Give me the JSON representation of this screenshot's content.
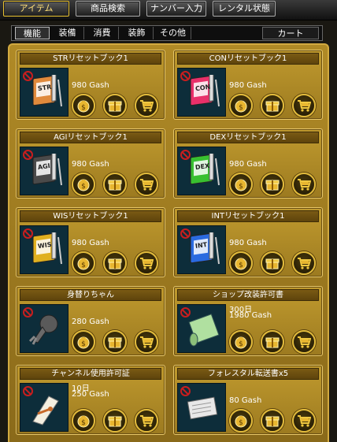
{
  "top_tabs": [
    {
      "label": "アイテム",
      "active": true
    },
    {
      "label": "商品検索",
      "active": false
    },
    {
      "label": "ナンバー入力",
      "active": false
    },
    {
      "label": "レンタル状態",
      "active": false
    }
  ],
  "sub_tabs": [
    {
      "label": "機能",
      "active": true
    },
    {
      "label": "装備",
      "active": false
    },
    {
      "label": "消費",
      "active": false
    },
    {
      "label": "装飾",
      "active": false
    },
    {
      "label": "その他",
      "active": false
    }
  ],
  "cart_label": "カート",
  "items": [
    {
      "name": "STRリセットブック1",
      "duration": "",
      "price": "980 Gash",
      "icon": "str-reset-book-icon",
      "book_color": "#e08a3c",
      "book_text": "STR"
    },
    {
      "name": "CONリセットブック1",
      "duration": "",
      "price": "980 Gash",
      "icon": "con-reset-book-icon",
      "book_color": "#e8306a",
      "book_text": "CON"
    },
    {
      "name": "AGIリセットブック1",
      "duration": "",
      "price": "980 Gash",
      "icon": "agi-reset-book-icon",
      "book_color": "#4a4a4a",
      "book_text": "AGI"
    },
    {
      "name": "DEXリセットブック1",
      "duration": "",
      "price": "980 Gash",
      "icon": "dex-reset-book-icon",
      "book_color": "#38c030",
      "book_text": "DEX"
    },
    {
      "name": "WISリセットブック1",
      "duration": "",
      "price": "980 Gash",
      "icon": "wis-reset-book-icon",
      "book_color": "#e0b020",
      "book_text": "WIS"
    },
    {
      "name": "INTリセットブック1",
      "duration": "",
      "price": "980 Gash",
      "icon": "int-reset-book-icon",
      "book_color": "#2a6ae0",
      "book_text": "INT"
    },
    {
      "name": "身替りちゃん",
      "duration": "",
      "price": "280 Gash",
      "icon": "substitute-doll-icon"
    },
    {
      "name": "ショップ改装許可書",
      "duration": "300日",
      "price": "1980 Gash",
      "icon": "shop-scroll-icon"
    },
    {
      "name": "チャンネル使用許可証",
      "duration": "10日",
      "price": "250 Gash",
      "icon": "channel-scroll-icon"
    },
    {
      "name": "フォレスタル転送書x5",
      "duration": "",
      "price": "80 Gash",
      "icon": "transfer-scroll-icon"
    }
  ],
  "colors": {
    "panel": "#b08a26",
    "card_border": "#e8c86a",
    "button_ring": "#e2bb3c",
    "restricted": "#c81e1e"
  }
}
